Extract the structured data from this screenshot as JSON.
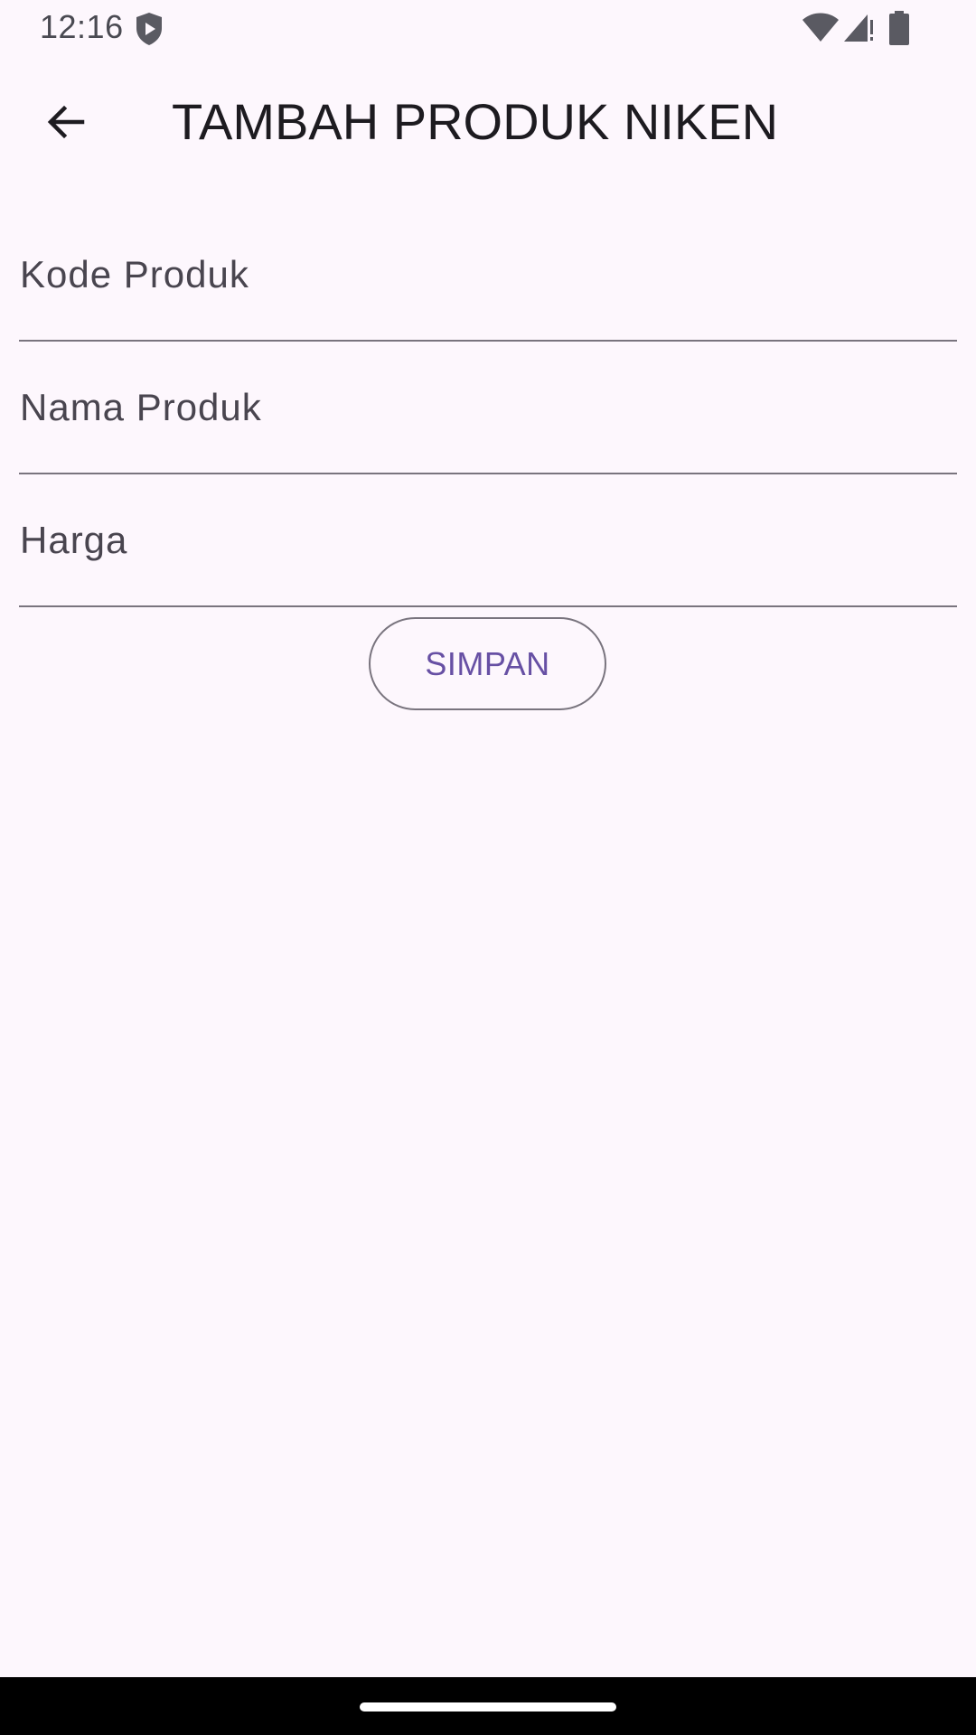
{
  "status_bar": {
    "time": "12:16",
    "icons": [
      "shield-play-icon",
      "wifi-icon",
      "signal-icon",
      "battery-icon"
    ]
  },
  "app_bar": {
    "back_icon": "arrow-back-icon",
    "title": "TAMBAH PRODUK NIKEN"
  },
  "form": {
    "fields": [
      {
        "placeholder": "Kode Produk",
        "value": ""
      },
      {
        "placeholder": "Nama Produk",
        "value": ""
      },
      {
        "placeholder": "Harga",
        "value": ""
      }
    ],
    "submit_label": "SIMPAN"
  },
  "colors": {
    "background": "#FDF7FD",
    "primary": "#6750A4",
    "outline": "#79747E",
    "on_surface": "#1D1B20",
    "nav_bar": "#000000"
  }
}
